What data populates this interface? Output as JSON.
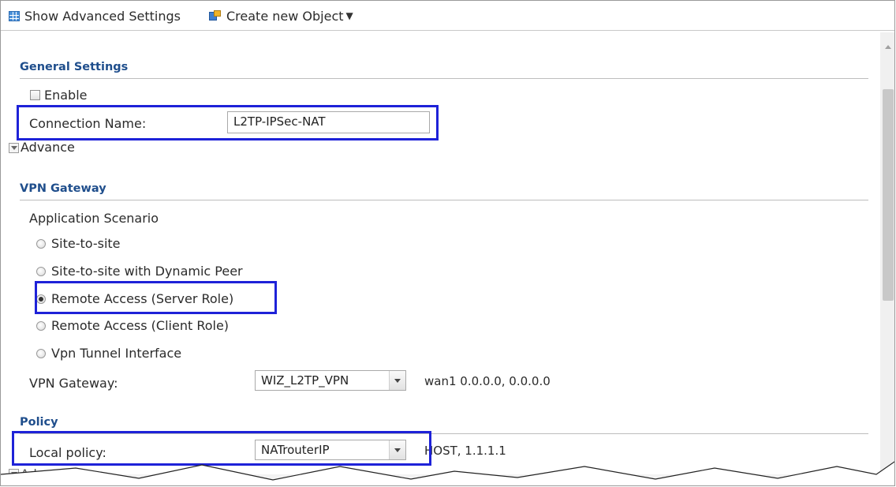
{
  "toolbar": {
    "show_advanced": "Show Advanced Settings",
    "create_object": "Create new Object"
  },
  "general": {
    "title": "General Settings",
    "enable_label": "Enable",
    "connection_name_label": "Connection Name:",
    "connection_name_value": "L2TP-IPSec-NAT",
    "advance_label": "Advance"
  },
  "vpn_gateway": {
    "title": "VPN Gateway",
    "scenario_label": "Application Scenario",
    "options": [
      "Site-to-site",
      "Site-to-site with Dynamic Peer",
      "Remote Access (Server Role)",
      "Remote Access (Client Role)",
      "Vpn Tunnel Interface"
    ],
    "selected_option": "Remote Access (Server Role)",
    "gateway_label": "VPN Gateway:",
    "gateway_value": "WIZ_L2TP_VPN",
    "gateway_info": "wan1  0.0.0.0, 0.0.0.0"
  },
  "policy": {
    "title": "Policy",
    "local_policy_label": "Local policy:",
    "local_policy_value": "NATrouterIP",
    "local_policy_info": "HOST, 1.1.1.1",
    "advance_label": "Advance"
  },
  "colors": {
    "section_title": "#1f4e8c",
    "highlight": "#1e22d8"
  }
}
